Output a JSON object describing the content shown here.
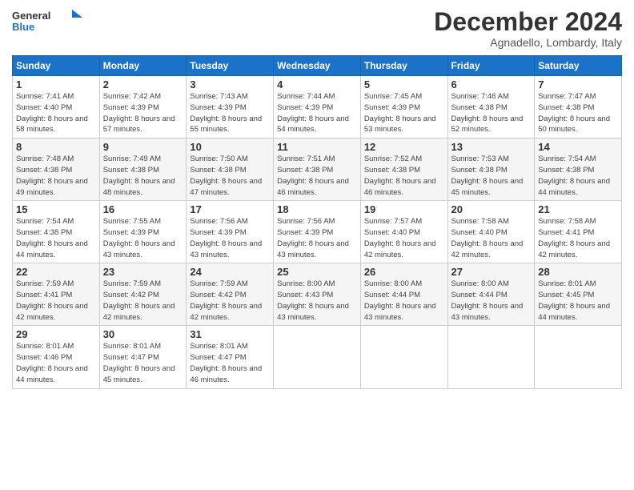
{
  "logo": {
    "line1": "General",
    "line2": "Blue"
  },
  "title": "December 2024",
  "location": "Agnadello, Lombardy, Italy",
  "days_header": [
    "Sunday",
    "Monday",
    "Tuesday",
    "Wednesday",
    "Thursday",
    "Friday",
    "Saturday"
  ],
  "weeks": [
    [
      {
        "day": "1",
        "sunrise": "7:41 AM",
        "sunset": "4:40 PM",
        "daylight": "8 hours and 58 minutes."
      },
      {
        "day": "2",
        "sunrise": "7:42 AM",
        "sunset": "4:39 PM",
        "daylight": "8 hours and 57 minutes."
      },
      {
        "day": "3",
        "sunrise": "7:43 AM",
        "sunset": "4:39 PM",
        "daylight": "8 hours and 55 minutes."
      },
      {
        "day": "4",
        "sunrise": "7:44 AM",
        "sunset": "4:39 PM",
        "daylight": "8 hours and 54 minutes."
      },
      {
        "day": "5",
        "sunrise": "7:45 AM",
        "sunset": "4:39 PM",
        "daylight": "8 hours and 53 minutes."
      },
      {
        "day": "6",
        "sunrise": "7:46 AM",
        "sunset": "4:38 PM",
        "daylight": "8 hours and 52 minutes."
      },
      {
        "day": "7",
        "sunrise": "7:47 AM",
        "sunset": "4:38 PM",
        "daylight": "8 hours and 50 minutes."
      }
    ],
    [
      {
        "day": "8",
        "sunrise": "7:48 AM",
        "sunset": "4:38 PM",
        "daylight": "8 hours and 49 minutes."
      },
      {
        "day": "9",
        "sunrise": "7:49 AM",
        "sunset": "4:38 PM",
        "daylight": "8 hours and 48 minutes."
      },
      {
        "day": "10",
        "sunrise": "7:50 AM",
        "sunset": "4:38 PM",
        "daylight": "8 hours and 47 minutes."
      },
      {
        "day": "11",
        "sunrise": "7:51 AM",
        "sunset": "4:38 PM",
        "daylight": "8 hours and 46 minutes."
      },
      {
        "day": "12",
        "sunrise": "7:52 AM",
        "sunset": "4:38 PM",
        "daylight": "8 hours and 46 minutes."
      },
      {
        "day": "13",
        "sunrise": "7:53 AM",
        "sunset": "4:38 PM",
        "daylight": "8 hours and 45 minutes."
      },
      {
        "day": "14",
        "sunrise": "7:54 AM",
        "sunset": "4:38 PM",
        "daylight": "8 hours and 44 minutes."
      }
    ],
    [
      {
        "day": "15",
        "sunrise": "7:54 AM",
        "sunset": "4:38 PM",
        "daylight": "8 hours and 44 minutes."
      },
      {
        "day": "16",
        "sunrise": "7:55 AM",
        "sunset": "4:39 PM",
        "daylight": "8 hours and 43 minutes."
      },
      {
        "day": "17",
        "sunrise": "7:56 AM",
        "sunset": "4:39 PM",
        "daylight": "8 hours and 43 minutes."
      },
      {
        "day": "18",
        "sunrise": "7:56 AM",
        "sunset": "4:39 PM",
        "daylight": "8 hours and 43 minutes."
      },
      {
        "day": "19",
        "sunrise": "7:57 AM",
        "sunset": "4:40 PM",
        "daylight": "8 hours and 42 minutes."
      },
      {
        "day": "20",
        "sunrise": "7:58 AM",
        "sunset": "4:40 PM",
        "daylight": "8 hours and 42 minutes."
      },
      {
        "day": "21",
        "sunrise": "7:58 AM",
        "sunset": "4:41 PM",
        "daylight": "8 hours and 42 minutes."
      }
    ],
    [
      {
        "day": "22",
        "sunrise": "7:59 AM",
        "sunset": "4:41 PM",
        "daylight": "8 hours and 42 minutes."
      },
      {
        "day": "23",
        "sunrise": "7:59 AM",
        "sunset": "4:42 PM",
        "daylight": "8 hours and 42 minutes."
      },
      {
        "day": "24",
        "sunrise": "7:59 AM",
        "sunset": "4:42 PM",
        "daylight": "8 hours and 42 minutes."
      },
      {
        "day": "25",
        "sunrise": "8:00 AM",
        "sunset": "4:43 PM",
        "daylight": "8 hours and 43 minutes."
      },
      {
        "day": "26",
        "sunrise": "8:00 AM",
        "sunset": "4:44 PM",
        "daylight": "8 hours and 43 minutes."
      },
      {
        "day": "27",
        "sunrise": "8:00 AM",
        "sunset": "4:44 PM",
        "daylight": "8 hours and 43 minutes."
      },
      {
        "day": "28",
        "sunrise": "8:01 AM",
        "sunset": "4:45 PM",
        "daylight": "8 hours and 44 minutes."
      }
    ],
    [
      {
        "day": "29",
        "sunrise": "8:01 AM",
        "sunset": "4:46 PM",
        "daylight": "8 hours and 44 minutes."
      },
      {
        "day": "30",
        "sunrise": "8:01 AM",
        "sunset": "4:47 PM",
        "daylight": "8 hours and 45 minutes."
      },
      {
        "day": "31",
        "sunrise": "8:01 AM",
        "sunset": "4:47 PM",
        "daylight": "8 hours and 46 minutes."
      },
      null,
      null,
      null,
      null
    ]
  ]
}
